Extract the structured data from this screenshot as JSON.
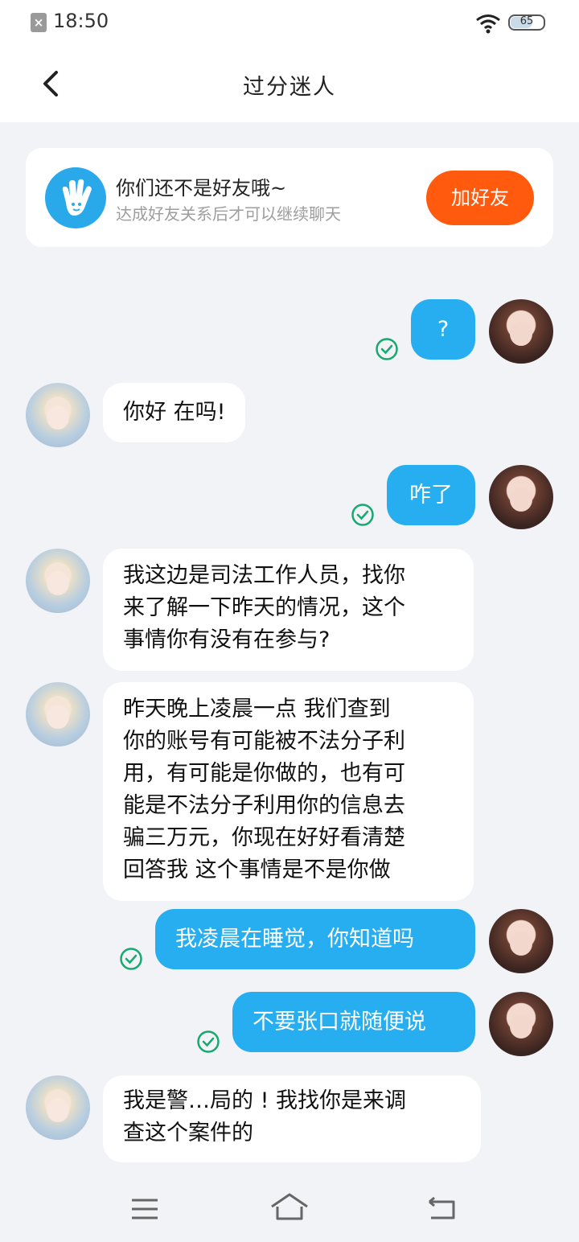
{
  "status": {
    "time": "18:50",
    "battery": "65"
  },
  "header": {
    "title": "过分迷人"
  },
  "friend_card": {
    "title": "你们还不是好友哦~",
    "subtitle": "达成好友关系后才可以继续聊天",
    "button": "加好友"
  },
  "messages": [
    {
      "side": "out",
      "text": "?"
    },
    {
      "side": "in",
      "text": "你好 在吗!"
    },
    {
      "side": "out",
      "text": "咋了"
    },
    {
      "side": "in",
      "text": "我这边是司法工作人员，找你\n来了解一下昨天的情况，这个\n事情你有没有在参与?"
    },
    {
      "side": "in",
      "text": "昨天晚上凌晨一点 我们查到\n你的账号有可能被不法分子利\n用，有可能是你做的，也有可\n能是不法分子利用你的信息去\n骗三万元，你现在好好看清楚\n回答我 这个事情是不是你做"
    },
    {
      "side": "out",
      "text": "我凌晨在睡觉，你知道吗"
    },
    {
      "side": "out",
      "text": "不要张口就随便说"
    },
    {
      "side": "in",
      "text": "我是警…局的 ! 我找你是来调\n查这个案件的"
    }
  ],
  "colors": {
    "accent": "#27aef0",
    "add_button": "#ff5a0e",
    "read_check": "#17a96e"
  },
  "icons": [
    "back-icon",
    "hand-wave-icon",
    "read-check-icon",
    "menu-icon",
    "home-icon",
    "return-icon"
  ]
}
